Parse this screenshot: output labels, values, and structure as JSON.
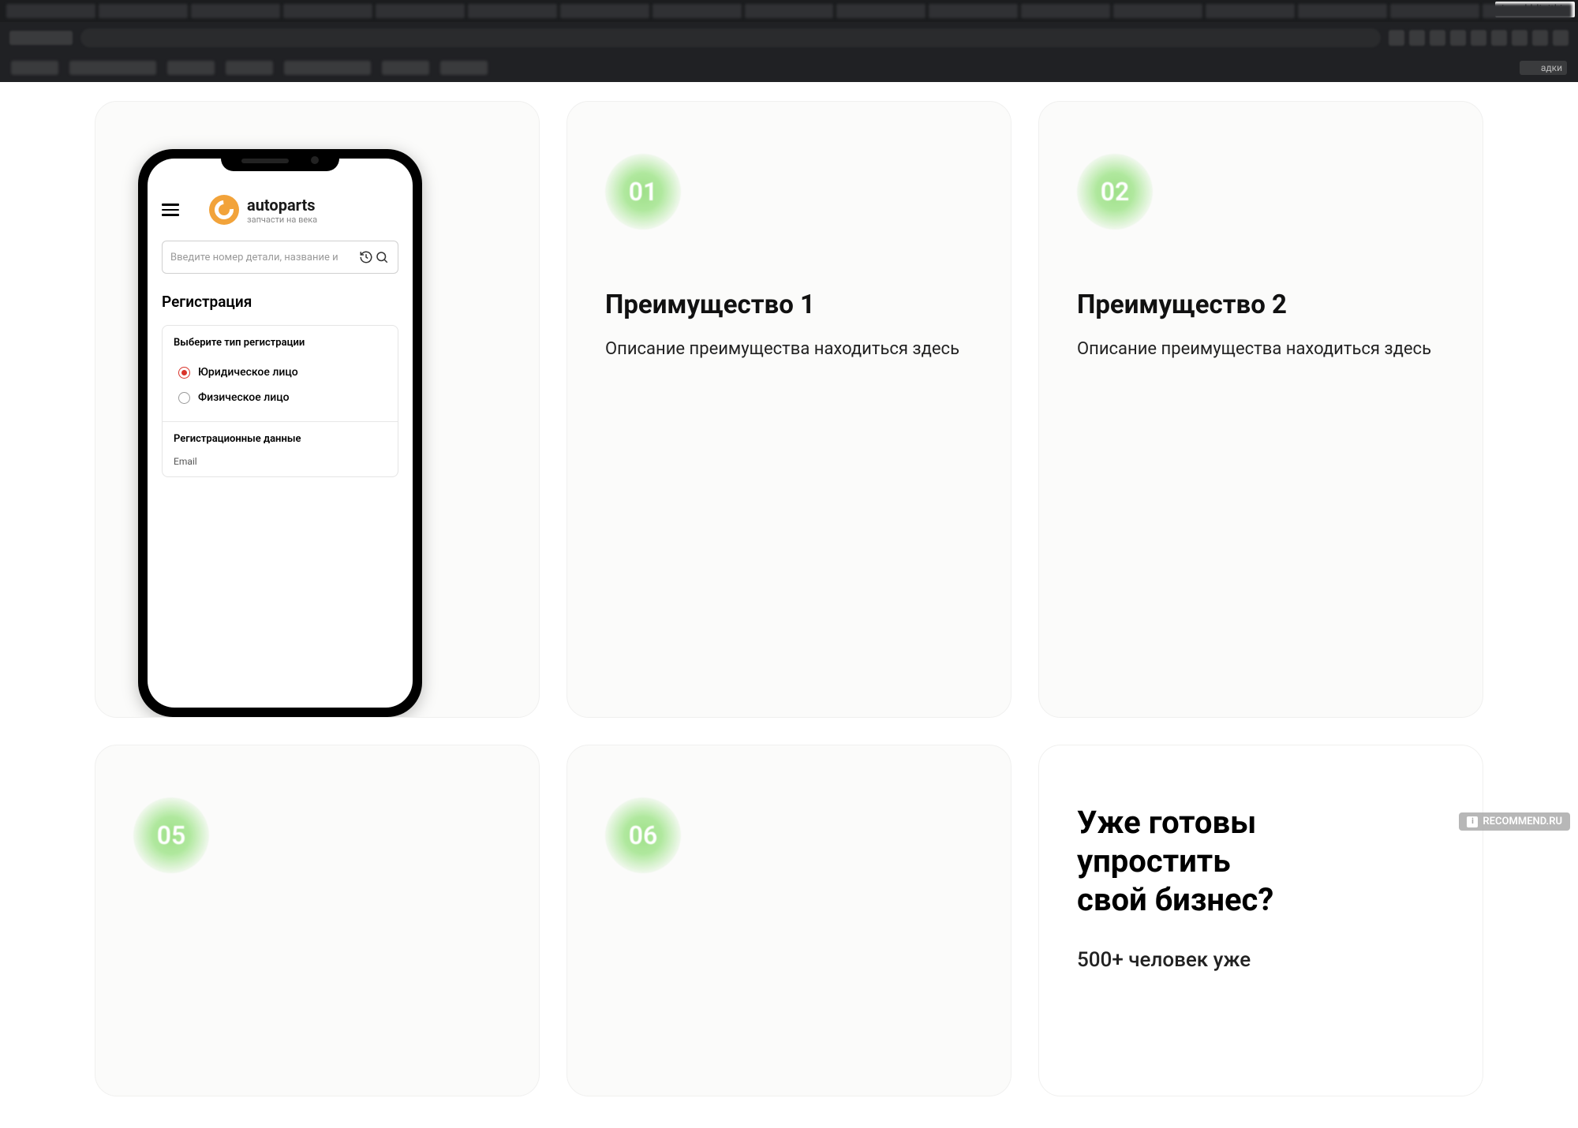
{
  "browser": {
    "profile_label": "ivan-khlipitkin",
    "bookmark_tail_label": "адки"
  },
  "phone": {
    "brand_name": "autoparts",
    "brand_tagline": "запчасти на века",
    "search_placeholder": "Введите номер детали, название и",
    "reg_title": "Регистрация",
    "reg_type_label": "Выберите тип регистрации",
    "reg_option_legal": "Юридическое лицо",
    "reg_option_person": "Физическое лицо",
    "reg_data_header": "Регистрационные данные",
    "field_email": "Email"
  },
  "cards": {
    "c01": {
      "num": "01",
      "title": "Преимущество 1",
      "desc": "Описание преимущества находиться здесь"
    },
    "c02": {
      "num": "02",
      "title": "Преимущество 2",
      "desc": "Описание преимущества находиться здесь"
    },
    "c05": {
      "num": "05"
    },
    "c06": {
      "num": "06"
    }
  },
  "cta": {
    "title_line1": "Уже готовы",
    "title_line2": "упростить",
    "title_line3": "свой бизнес?",
    "subline": "500+ человек уже"
  },
  "watermark": "RECOMMEND.RU"
}
